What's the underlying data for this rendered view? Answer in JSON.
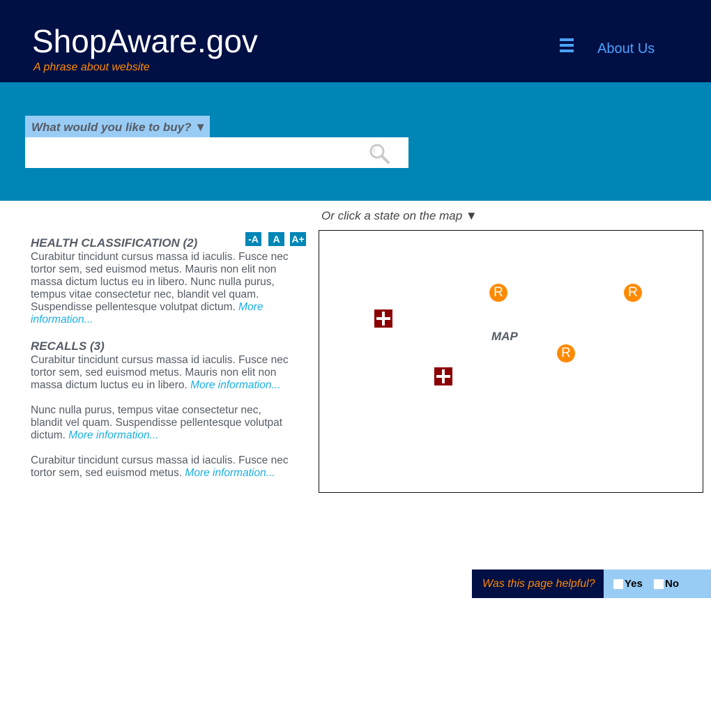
{
  "header": {
    "site_title": "ShopAware.gov",
    "tagline": "A phrase about website",
    "about_label": "About Us"
  },
  "search": {
    "category_label": "What would you like to buy?",
    "dropdown_arrow": "▼",
    "placeholder": "",
    "value": ""
  },
  "map_prompt": "Or click a state on the map ▼",
  "font_controls": [
    "-A",
    "A",
    "A+"
  ],
  "content": {
    "health": {
      "title": "HEALTH CLASSIFICATION (2)",
      "body": "Curabitur tincidunt cursus massa id iaculis. Fusce nec tortor sem, sed euismod metus. Mauris non elit non massa dictum luctus eu in libero. Nunc nulla purus, tempus vitae consectetur nec, blandit vel quam. Suspendisse pellentesque volutpat dictum.",
      "link": "More information..."
    },
    "recalls": {
      "title": "RECALLS (3)",
      "items": [
        {
          "body": "Curabitur tincidunt cursus massa id iaculis. Fusce nec tortor sem, sed euismod metus. Mauris non elit non massa dictum luctus eu in libero.",
          "link": "More information..."
        },
        {
          "body": "Nunc nulla purus, tempus vitae consectetur nec, blandit vel quam. Suspendisse pellentesque volutpat dictum.",
          "link": "More information..."
        },
        {
          "body": "Curabitur tincidunt cursus massa id iaculis. Fusce nec tortor sem, sed euismod metus.",
          "link": "More information..."
        }
      ]
    }
  },
  "map": {
    "label": "MAP",
    "recall_marker_letter": "R"
  },
  "feedback": {
    "question": "Was this page helpful?",
    "yes_label": "Yes",
    "no_label": "No"
  },
  "colors": {
    "header_bg": "#000f44",
    "search_band_bg": "#0086b6",
    "accent_orange": "#ff8a00",
    "link_blue": "#1aaee3",
    "nav_blue": "#4aa3ff",
    "light_blue": "#99ccf5",
    "health_marker": "#8b0000"
  },
  "icons": [
    "menu-icon",
    "search-icon",
    "recall-marker-icon",
    "health-marker-icon"
  ]
}
